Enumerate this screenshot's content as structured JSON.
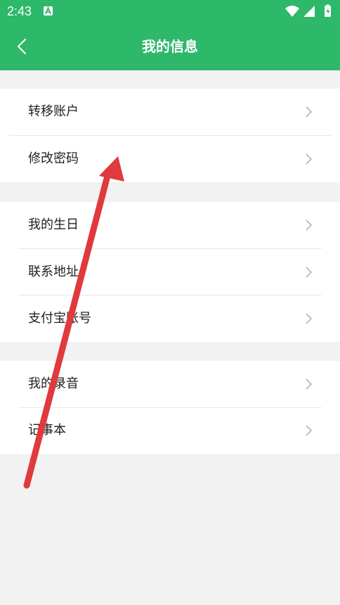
{
  "status_bar": {
    "time": "2:43",
    "icons": [
      "accessibility-a-icon",
      "wifi-icon",
      "signal-icon",
      "battery-charging-icon"
    ]
  },
  "header": {
    "title": "我的信息",
    "back_icon": "chevron-left-icon"
  },
  "groups": [
    {
      "items": [
        {
          "label": "转移账户"
        },
        {
          "label": "修改密码"
        }
      ]
    },
    {
      "items": [
        {
          "label": "我的生日"
        },
        {
          "label": "联系地址"
        },
        {
          "label": "支付宝账号"
        }
      ]
    },
    {
      "items": [
        {
          "label": "我的录音"
        },
        {
          "label": "记事本"
        }
      ]
    }
  ],
  "colors": {
    "brand_green": "#2eb86a",
    "page_background": "#f2f2f2",
    "annotation_arrow": "#e0393e"
  }
}
